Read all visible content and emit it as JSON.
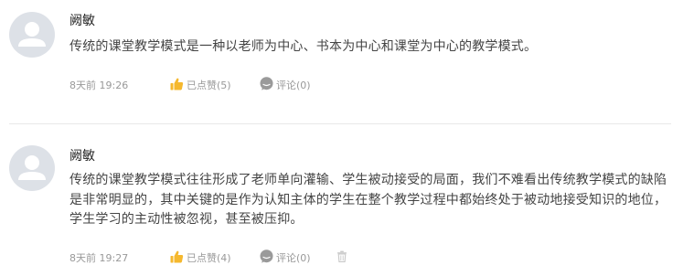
{
  "comments": [
    {
      "author": "阙敏",
      "content": "传统的课堂教学模式是一种以老师为中心、书本为中心和课堂为中心的教学模式。",
      "time": "8天前 19:26",
      "likes": "已点赞(5)",
      "replies": "评论(0)"
    },
    {
      "author": "阙敏",
      "content": "传统的课堂教学模式往往形成了老师单向灌输、学生被动接受的局面，我们不难看出传统教学模式的缺陷是非常明显的，其中关键的是作为认知主体的学生在整个教学过程中都始终处于被动地接受知识的地位，学生学习的主动性被忽视，甚至被压抑。",
      "time": "8天前 19:27",
      "likes": "已点赞(4)",
      "replies": "评论(0)"
    }
  ],
  "colors": {
    "like_icon": "#f5b82e",
    "comment_icon": "#9a9a9a",
    "avatar_bg": "#dde1e7",
    "meta_text": "#999999"
  },
  "icons": {
    "avatar": "user-avatar-icon",
    "like": "thumbs-up-icon",
    "comment": "speech-bubble-icon",
    "delete": "trash-icon"
  }
}
